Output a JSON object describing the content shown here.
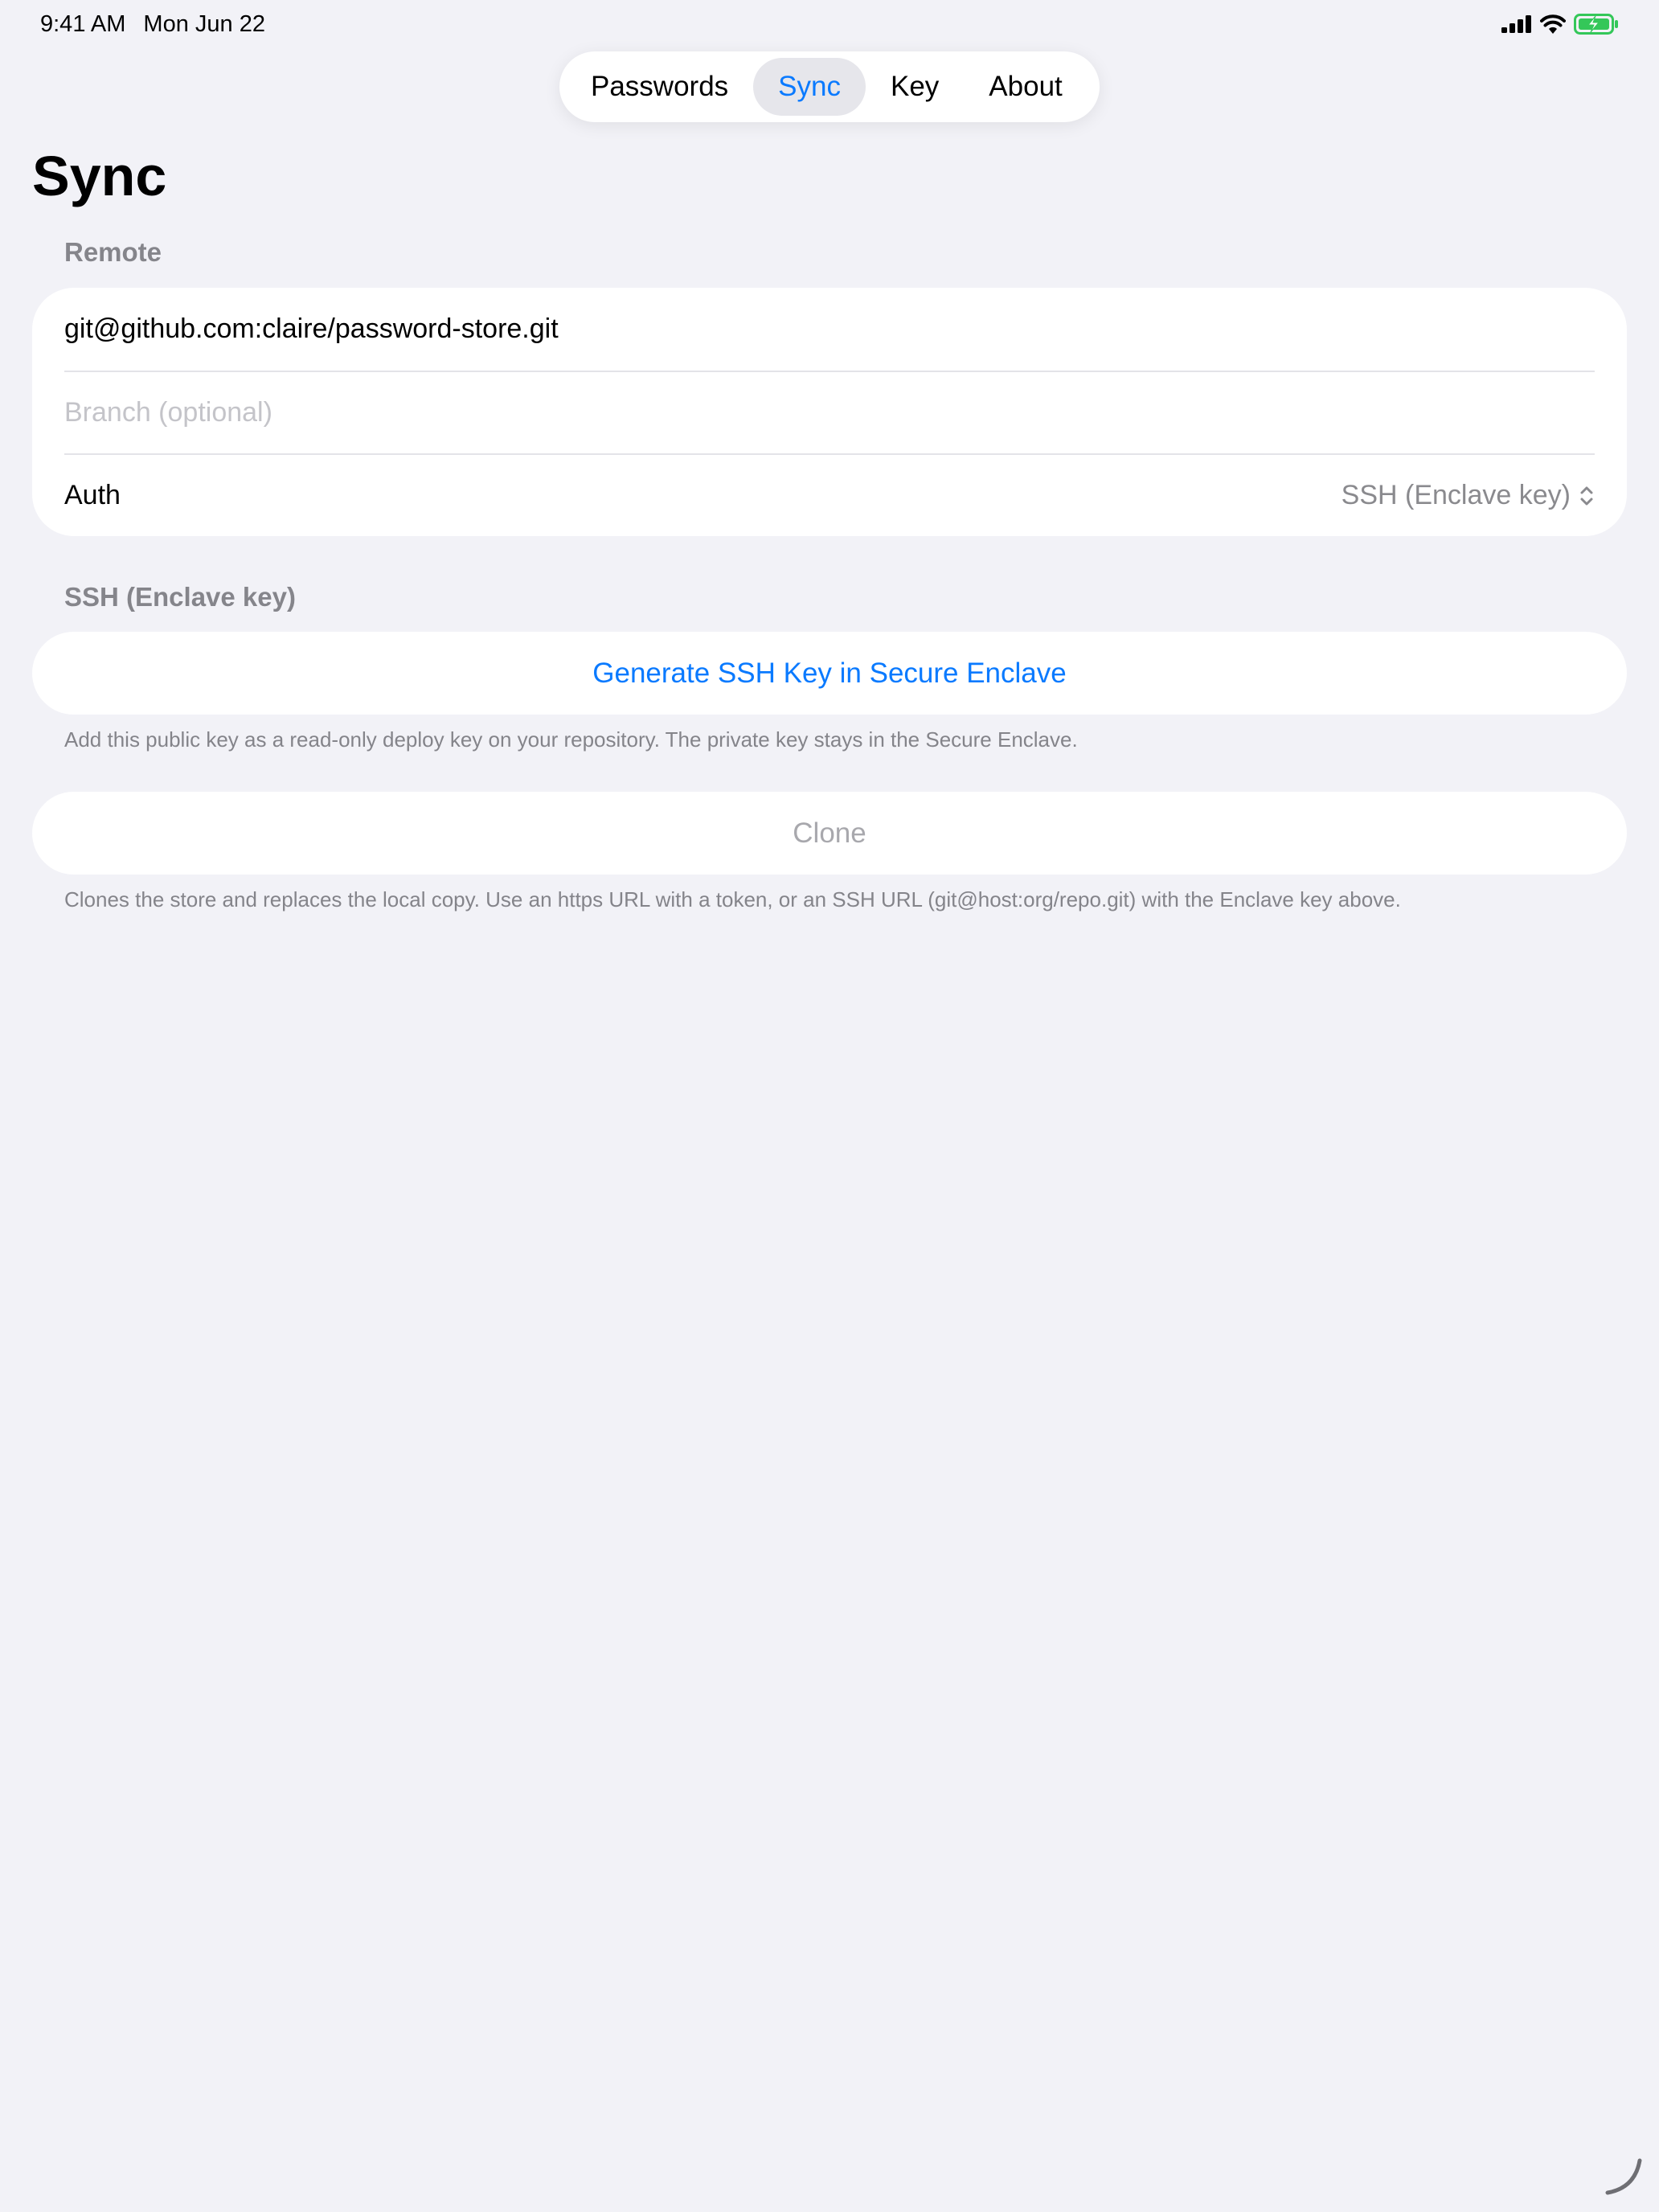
{
  "status_bar": {
    "time": "9:41 AM",
    "date": "Mon Jun 22",
    "icons": [
      "cellular-signal-icon",
      "wifi-icon",
      "battery-charging-icon"
    ],
    "battery_color": "#34c759"
  },
  "tabs": [
    {
      "label": "Passwords",
      "selected": false
    },
    {
      "label": "Sync",
      "selected": true
    },
    {
      "label": "Key",
      "selected": false
    },
    {
      "label": "About",
      "selected": false
    }
  ],
  "page": {
    "title": "Sync"
  },
  "remote": {
    "header": "Remote",
    "url_value": "git@github.com:claire/password-store.git",
    "branch_placeholder": "Branch (optional)",
    "auth_label": "Auth",
    "auth_value": "SSH (Enclave key)",
    "auth_icon": "chevron-up-down-icon"
  },
  "ssh": {
    "header": "SSH (Enclave key)",
    "generate_button": "Generate SSH Key in Secure Enclave",
    "note": "Add this public key as a read-only deploy key on your repository. The private key stays in the Secure Enclave."
  },
  "clone": {
    "button": "Clone",
    "enabled": false,
    "note": "Clones the store and replaces the local copy. Use an https URL with a token, or an SSH URL (git@host:org/repo.git) with the Enclave key above."
  },
  "colors": {
    "accent": "#0a7aff",
    "background": "#f2f2f7",
    "secondary_text": "#8a8a8e"
  }
}
